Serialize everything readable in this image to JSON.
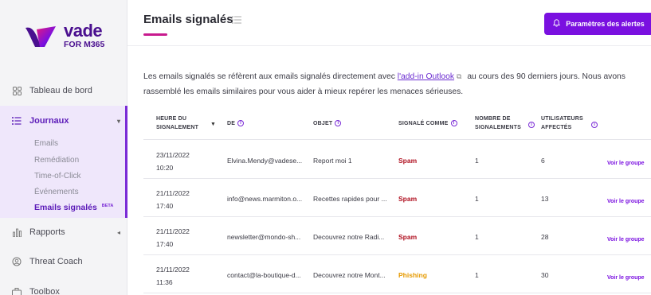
{
  "brand": {
    "name": "vade",
    "subtitle": "FOR M365",
    "color": "#4a0f8f"
  },
  "sidebar": {
    "items": [
      {
        "label": "Tableau de bord",
        "icon": "grid-icon"
      },
      {
        "label": "Journaux",
        "icon": "list-icon",
        "active": true
      },
      {
        "label": "Rapports",
        "icon": "bar-chart-icon"
      },
      {
        "label": "Threat Coach",
        "icon": "coach-icon"
      },
      {
        "label": "Toolbox",
        "icon": "toolbox-icon"
      }
    ],
    "journaux_sub": [
      {
        "label": "Emails"
      },
      {
        "label": "Remédiation"
      },
      {
        "label": "Time-of-Click"
      },
      {
        "label": "Événements"
      },
      {
        "label": "Emails signalés",
        "badge": "BETA",
        "active": true
      }
    ]
  },
  "header": {
    "title": "Emails signalés",
    "alert_button": "Paramètres des alertes",
    "accent": "#7a10e0",
    "underline_color": "#c81a8e"
  },
  "intro": {
    "before_link": "Les emails signalés se réfèrent aux emails signalés directement avec ",
    "link": "l'add-in Outlook",
    "after_link": " au cours des 90 derniers jours. Nous avons rassemblé les emails similaires pour vous aider à mieux repérer les menaces sérieuses."
  },
  "table": {
    "columns": {
      "date": "HEURE DU SIGNALEMENT",
      "de": "DE",
      "objet": "OBJET",
      "signale": "SIGNALÉ COMME",
      "nombre": "NOMBRE DE SIGNALEMENTS",
      "users": "UTILISATEURS AFFECTÉS"
    },
    "rows": [
      {
        "date": "23/11/2022",
        "time": "10:20",
        "de": "Elvina.Mendy@vadese...",
        "objet": "Report moi 1",
        "signale": "Spam",
        "nombre": "1",
        "users": "6",
        "link": "Voir le groupe"
      },
      {
        "date": "21/11/2022",
        "time": "17:40",
        "de": "info@news.marmiton.o...",
        "objet": "Recettes rapides pour ...",
        "signale": "Spam",
        "nombre": "1",
        "users": "13",
        "link": "Voir le groupe"
      },
      {
        "date": "21/11/2022",
        "time": "17:40",
        "de": "newsletter@mondo-sh...",
        "objet": "Decouvrez notre Radi...",
        "signale": "Spam",
        "nombre": "1",
        "users": "28",
        "link": "Voir le groupe"
      },
      {
        "date": "21/11/2022",
        "time": "11:36",
        "de": "contact@la-boutique-d...",
        "objet": "Decouvrez notre Mont...",
        "signale": "Phishing",
        "nombre": "1",
        "users": "30",
        "link": "Voir le groupe"
      }
    ],
    "colors": {
      "spam": "#b01020",
      "phishing": "#e69a00"
    }
  }
}
